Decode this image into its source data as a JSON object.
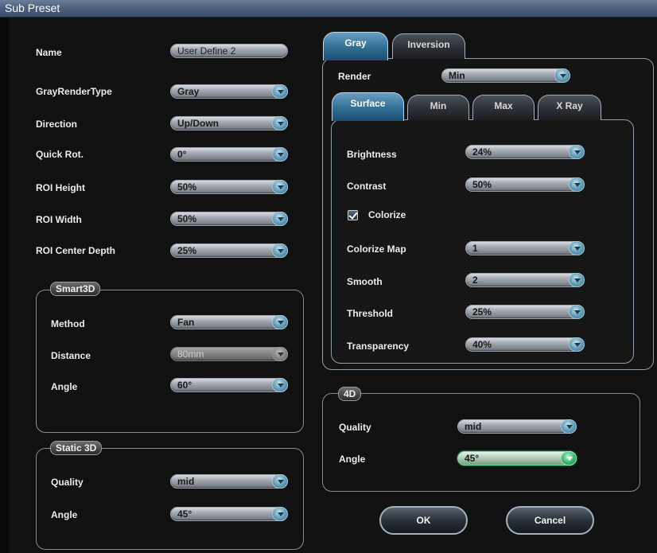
{
  "window": {
    "title": "Sub Preset"
  },
  "left_fields": [
    {
      "label": "Name",
      "value": "User Define 2"
    },
    {
      "label": "GrayRenderType",
      "value": "Gray"
    },
    {
      "label": "Direction",
      "value": "Up/Down"
    },
    {
      "label": "Quick Rot.",
      "value": "0°"
    },
    {
      "label": "ROI Height",
      "value": "50%"
    },
    {
      "label": "ROI Width",
      "value": "50%"
    },
    {
      "label": "ROI Center Depth",
      "value": "25%"
    }
  ],
  "smart3d": {
    "title": "Smart3D",
    "method": {
      "label": "Method",
      "value": "Fan"
    },
    "distance": {
      "label": "Distance",
      "value": "80mm",
      "disabled": true
    },
    "angle": {
      "label": "Angle",
      "value": "60°"
    }
  },
  "static3d": {
    "title": "Static 3D",
    "quality": {
      "label": "Quality",
      "value": "mid"
    },
    "angle": {
      "label": "Angle",
      "value": "45°"
    }
  },
  "outer_tabs": [
    {
      "label": "Gray",
      "selected": true
    },
    {
      "label": "Inversion",
      "selected": false
    }
  ],
  "render": {
    "label": "Render",
    "value": "Min"
  },
  "inner_tabs": [
    {
      "label": "Surface",
      "selected": true
    },
    {
      "label": "Min",
      "selected": false
    },
    {
      "label": "Max",
      "selected": false
    },
    {
      "label": "X Ray",
      "selected": false
    }
  ],
  "surface": {
    "brightness": {
      "label": "Brightness",
      "value": "24%"
    },
    "contrast": {
      "label": "Contrast",
      "value": "50%"
    },
    "colorize": {
      "label": "Colorize",
      "checked": true
    },
    "colorize_map": {
      "label": "Colorize Map",
      "value": "1"
    },
    "smooth": {
      "label": "Smooth",
      "value": "2"
    },
    "threshold": {
      "label": "Threshold",
      "value": "25%"
    },
    "transparency": {
      "label": "Transparency",
      "value": "40%"
    }
  },
  "fourd": {
    "title": "4D",
    "quality": {
      "label": "Quality",
      "value": "mid"
    },
    "angle": {
      "label": "Angle",
      "value": "45°"
    }
  },
  "buttons": {
    "ok": "OK",
    "cancel": "Cancel"
  },
  "colors": {
    "title_bar": "#4b5f7d",
    "selected_tab": "#2f6e95",
    "active_dropdown": "#3fbf73"
  }
}
